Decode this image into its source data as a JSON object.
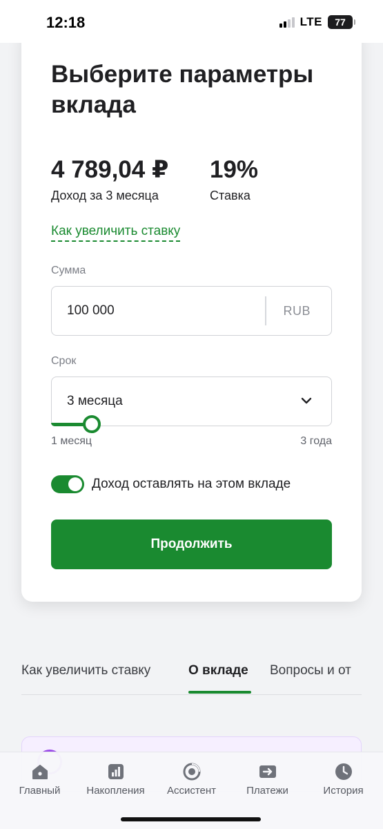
{
  "status_bar": {
    "time": "12:18",
    "network": "LTE",
    "battery": "77"
  },
  "card": {
    "title": "Выберите параметры вклада",
    "income_value": "4 789,04 ₽",
    "income_label": "Доход за 3 месяца",
    "rate_value": "19%",
    "rate_label": "Ставка",
    "rate_link": "Как увеличить ставку",
    "amount_label": "Сумма",
    "amount_value": "100 000",
    "currency": "RUB",
    "term_label": "Срок",
    "term_value": "3 месяца",
    "term_min": "1 месяц",
    "term_max": "3 года",
    "term_slider_fraction": 0.06,
    "reinvest_toggle_on": true,
    "reinvest_label": "Доход оставлять на этом вкладе",
    "continue_label": "Продолжить"
  },
  "tabs": [
    {
      "label": "Как увеличить ставку",
      "active": false
    },
    {
      "label": "О вкладе",
      "active": true
    },
    {
      "label": "Вопросы и от",
      "active": false
    }
  ],
  "bottom_nav": [
    {
      "label": "Главный",
      "icon": "home-icon"
    },
    {
      "label": "Накопления",
      "icon": "savings-chart-icon"
    },
    {
      "label": "Ассистент",
      "icon": "assistant-icon"
    },
    {
      "label": "Платежи",
      "icon": "payments-arrow-icon"
    },
    {
      "label": "История",
      "icon": "history-clock-icon"
    }
  ],
  "colors": {
    "accent": "#1a8a30",
    "text": "#1f1f22",
    "muted": "#7b7e86",
    "promo_bg": "#f6efff",
    "promo_accent": "#9a4be8"
  }
}
